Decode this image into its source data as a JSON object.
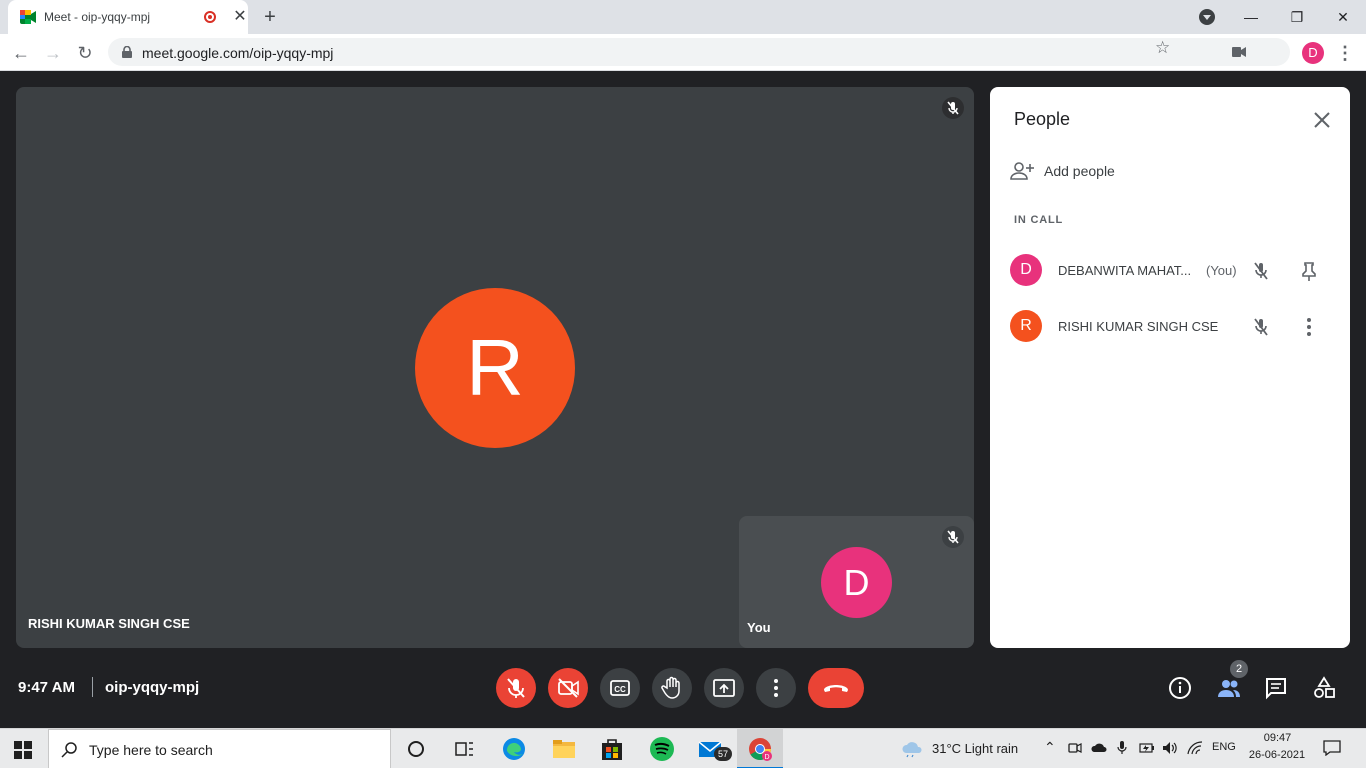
{
  "browser": {
    "tab": {
      "title": "Meet - oip-yqqy-mpj",
      "close_glyph": "✕"
    },
    "new_tab_glyph": "+",
    "window_controls": {
      "minimize": "—",
      "restore": "❐",
      "close": "✕"
    },
    "nav": {
      "back": "←",
      "forward": "→",
      "reload": "↻"
    },
    "address": {
      "url": "meet.google.com/oip-yqqy-mpj"
    },
    "star_glyph": "☆",
    "profile_initial": "D",
    "menu_glyph": "⋮"
  },
  "meet": {
    "main_tile": {
      "initial": "R",
      "name": "RISHI KUMAR SINGH CSE",
      "avatar_color": "#f4511e"
    },
    "self_tile": {
      "initial": "D",
      "name": "You",
      "avatar_color": "#e8327c"
    },
    "people_panel": {
      "title": "People",
      "add_people_label": "Add people",
      "section_label": "IN CALL",
      "participants": [
        {
          "initial": "D",
          "name": "DEBANWITA MAHAT...",
          "suffix": "(You)",
          "color": "#e8327c",
          "action_icon": "pin-icon"
        },
        {
          "initial": "R",
          "name": "RISHI KUMAR SINGH CSE",
          "suffix": "",
          "color": "#f4511e",
          "action_icon": "more-options-icon"
        }
      ]
    },
    "bottom_bar": {
      "time": "9:47 AM",
      "meeting_code": "oip-yqqy-mpj",
      "controls": [
        "mic-off-icon",
        "camera-off-icon",
        "captions-icon",
        "raise-hand-icon",
        "present-screen-icon",
        "more-options-icon",
        "end-call-icon"
      ],
      "people_count": "2"
    }
  },
  "taskbar": {
    "search_placeholder": "Type here to search",
    "mail_badge": "57",
    "weather": "31°C  Light rain",
    "language": "ENG",
    "time": "09:47",
    "date": "26-06-2021"
  },
  "colors": {
    "meet_bg": "#202124",
    "tile_bg": "#3c4043",
    "danger": "#ea4335",
    "accent": "#1a73e8"
  }
}
